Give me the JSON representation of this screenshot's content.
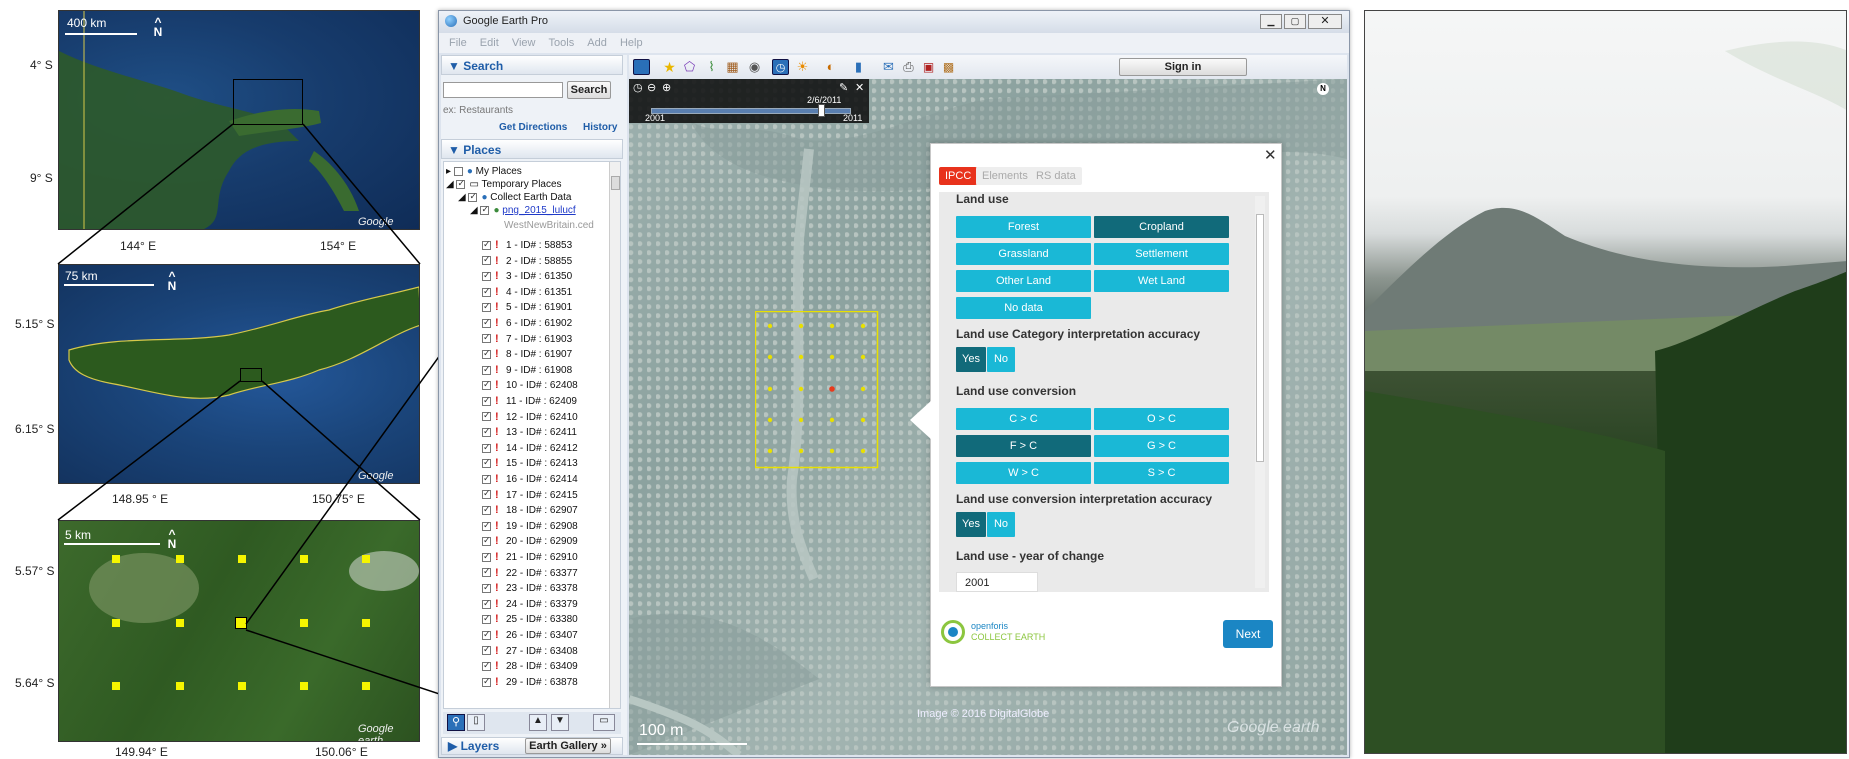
{
  "maps": {
    "map1": {
      "scale": "400 km",
      "north": "N",
      "ylabels": [
        "4° S",
        "9° S"
      ],
      "xlabels": [
        "144° E",
        "154° E"
      ],
      "logo": "Google earth"
    },
    "map2": {
      "scale": "75 km",
      "north": "N",
      "ylabels": [
        "5.15° S",
        "6.15° S"
      ],
      "xlabels": [
        "148.95 ° E",
        "150.75° E"
      ],
      "logo": "Google earth"
    },
    "map3": {
      "scale": "5 km",
      "north": "N",
      "ylabels": [
        "5.57° S",
        "5.64° S"
      ],
      "xlabels": [
        "149.94° E",
        "150.06° E"
      ],
      "logo": "Google earth"
    }
  },
  "window": {
    "title": "Google Earth Pro",
    "menu": [
      "File",
      "Edit",
      "View",
      "Tools",
      "Add",
      "Help"
    ],
    "sign_in": "Sign in"
  },
  "search": {
    "header": "▼ Search",
    "button": "Search",
    "placeholder": "ex: Restaurants",
    "get_directions": "Get Directions",
    "history": "History"
  },
  "places": {
    "header": "▼ Places",
    "tree": [
      "My Places",
      "Temporary Places",
      "Collect Earth Data",
      "png_2015_lulucf",
      "WestNewBritain.ced"
    ],
    "items": [
      "1 - ID# : 58853",
      "2 - ID# : 58855",
      "3 - ID# : 61350",
      "4 - ID# : 61351",
      "5 - ID# : 61901",
      "6 - ID# : 61902",
      "7 - ID# : 61903",
      "8 - ID# : 61907",
      "9 - ID# : 61908",
      "10 - ID# : 62408",
      "11 - ID# : 62409",
      "12 - ID# : 62410",
      "13 - ID# : 62411",
      "14 - ID# : 62412",
      "15 - ID# : 62413",
      "16 - ID# : 62414",
      "17 - ID# : 62415",
      "18 - ID# : 62907",
      "19 - ID# : 62908",
      "20 - ID# : 62909",
      "21 - ID# : 62910",
      "22 - ID# : 63377",
      "23 - ID# : 63378",
      "24 - ID# : 63379",
      "25 - ID# : 63380",
      "26 - ID# : 63407",
      "27 - ID# : 63408",
      "28 - ID# : 63409",
      "29 - ID# : 63878"
    ]
  },
  "layers": {
    "header": "▶ Layers",
    "gallery": "Earth Gallery »"
  },
  "timeline": {
    "date": "2/6/2011",
    "start": "2001",
    "end": "2011",
    "position": 0.85
  },
  "view": {
    "scale": "100 m",
    "credit": "Image © 2016 DigitalGlobe",
    "logo": "Google earth",
    "north": "N"
  },
  "form": {
    "tabs": [
      "IPCC",
      "Elements",
      "RS data"
    ],
    "land_use_title": "Land use",
    "land_use": [
      {
        "label": "Forest",
        "selected": false
      },
      {
        "label": "Cropland",
        "selected": true
      },
      {
        "label": "Grassland",
        "selected": false
      },
      {
        "label": "Settlement",
        "selected": false
      },
      {
        "label": "Other Land",
        "selected": false
      },
      {
        "label": "Wet Land",
        "selected": false
      },
      {
        "label": "No data",
        "selected": false
      }
    ],
    "accuracy_title": "Land use Category interpretation accuracy",
    "yes": "Yes",
    "no": "No",
    "conversion_title": "Land use conversion",
    "conversion": [
      {
        "label": "C > C",
        "selected": false
      },
      {
        "label": "O > C",
        "selected": false
      },
      {
        "label": "F > C",
        "selected": true
      },
      {
        "label": "G > C",
        "selected": false
      },
      {
        "label": "W > C",
        "selected": false
      },
      {
        "label": "S > C",
        "selected": false
      }
    ],
    "conv_accuracy_title": "Land use conversion interpretation accuracy",
    "year_title": "Land use - year of change",
    "year_value": "2001",
    "logo_top": "openforis",
    "logo_bottom": "COLLECT EARTH",
    "next": "Next"
  },
  "colors": {
    "accent": "#1ab8d6",
    "accent_selected": "#116a7a",
    "tab_active": "#e8321c",
    "next": "#1b86c4",
    "yellow": "#f5f500"
  }
}
